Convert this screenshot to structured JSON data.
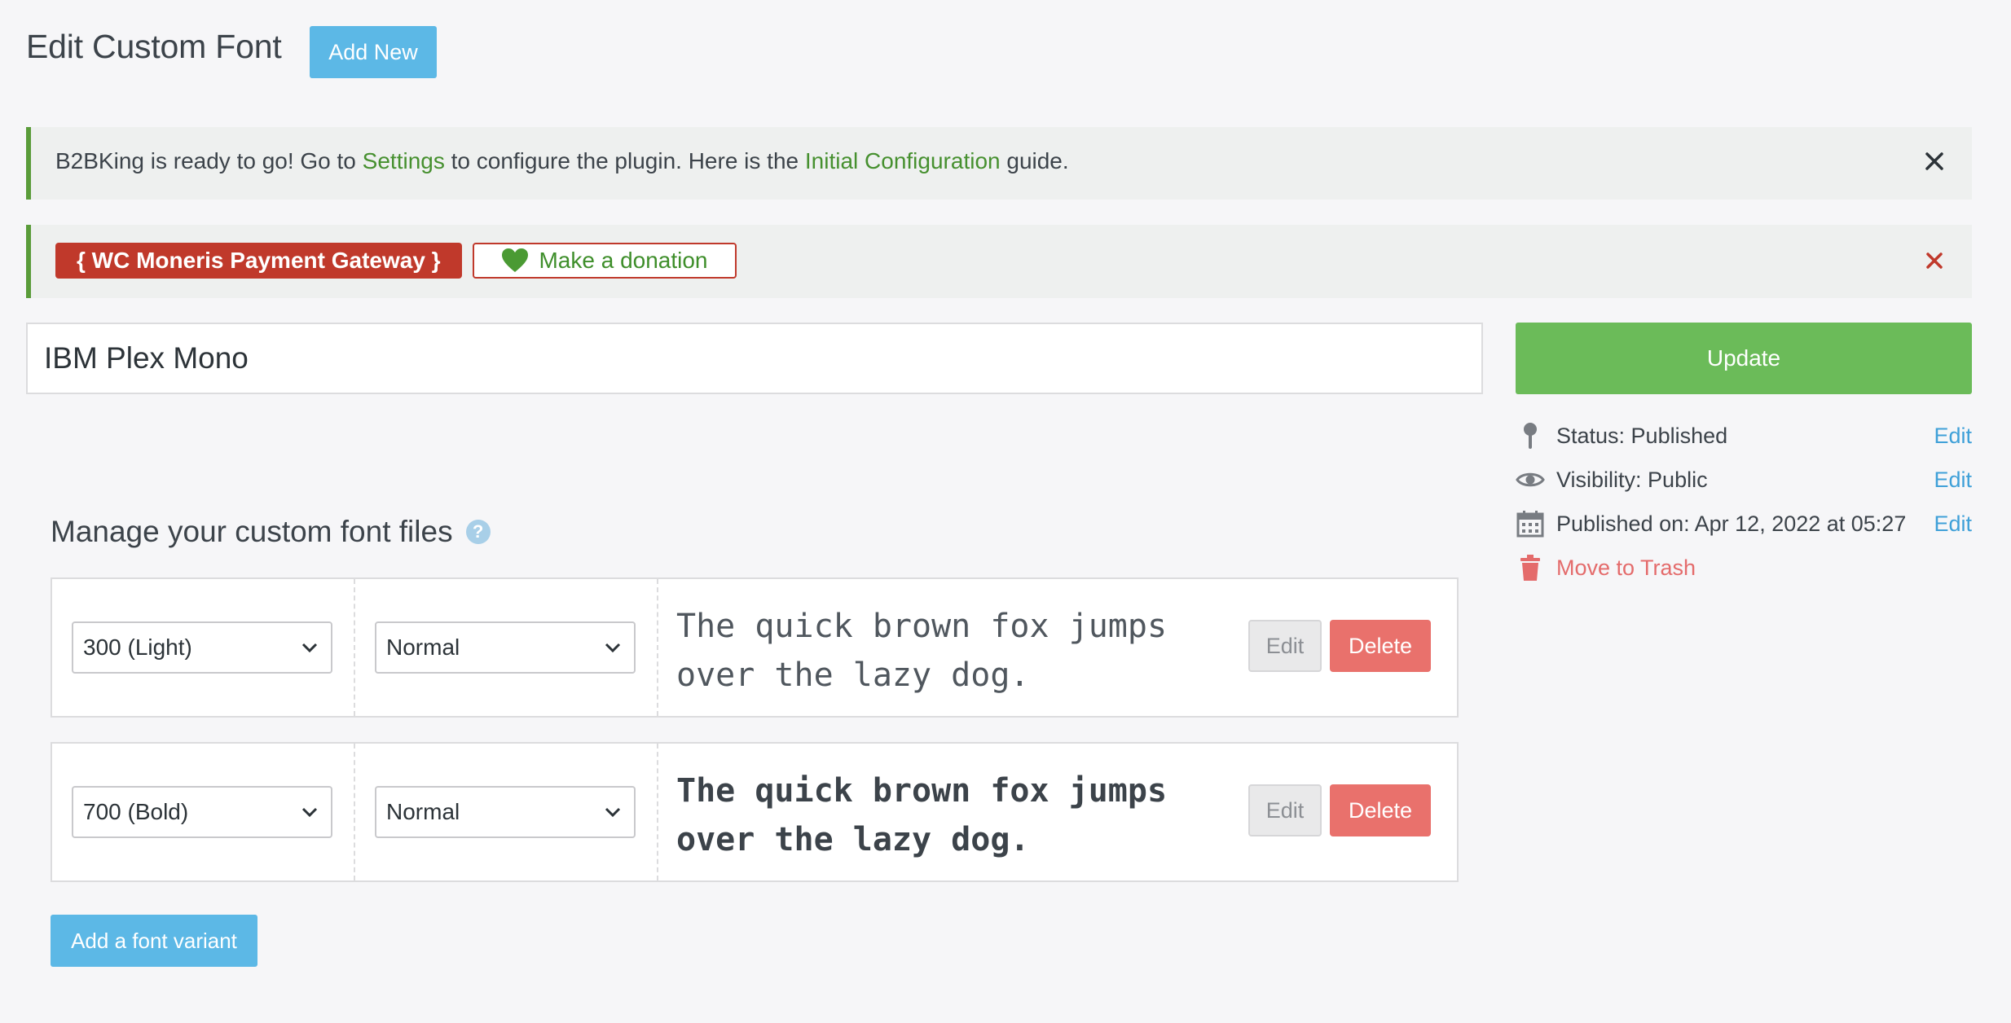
{
  "header": {
    "title": "Edit Custom Font",
    "add_new_label": "Add New"
  },
  "notice_b2bking": {
    "text_before": "B2BKing is ready to go! Go to ",
    "settings_link": "Settings",
    "text_middle": " to configure the plugin. Here is the ",
    "config_link": "Initial Configuration",
    "text_after": " guide.",
    "dismiss_icon": "close-icon"
  },
  "notice_moneris": {
    "badge": "{ WC Moneris Payment Gateway }",
    "donate_label": "Make a donation",
    "donate_icon": "heart-icon",
    "dismiss_icon": "close-icon"
  },
  "font_title": "IBM Plex Mono",
  "sidebar": {
    "update_label": "Update",
    "status_label": "Status: ",
    "status_value": "Published",
    "visibility_label": "Visibility: ",
    "visibility_value": "Public",
    "published_label": "Published on: ",
    "published_value": "Apr 12, 2022 at 05:27",
    "edit_label": "Edit",
    "trash_label": "Move to Trash"
  },
  "manage": {
    "title": "Manage your custom font files",
    "help_icon": "?",
    "edit_label": "Edit",
    "delete_label": "Delete",
    "add_variant_label": "Add a font variant",
    "variants": [
      {
        "weight": "300 (Light)",
        "style": "Normal",
        "sample_line1": "The quick brown fox jumps",
        "sample_line2": "over the lazy dog."
      },
      {
        "weight": "700 (Bold)",
        "style": "Normal",
        "sample_line1": "The quick brown fox jumps",
        "sample_line2": "over the lazy dog."
      }
    ]
  },
  "colors": {
    "accent_blue": "#5cb8e6",
    "update_green": "#6bbb59",
    "notice_green": "#5a9c3a",
    "danger_red": "#e9716c",
    "badge_red": "#c0392b"
  }
}
